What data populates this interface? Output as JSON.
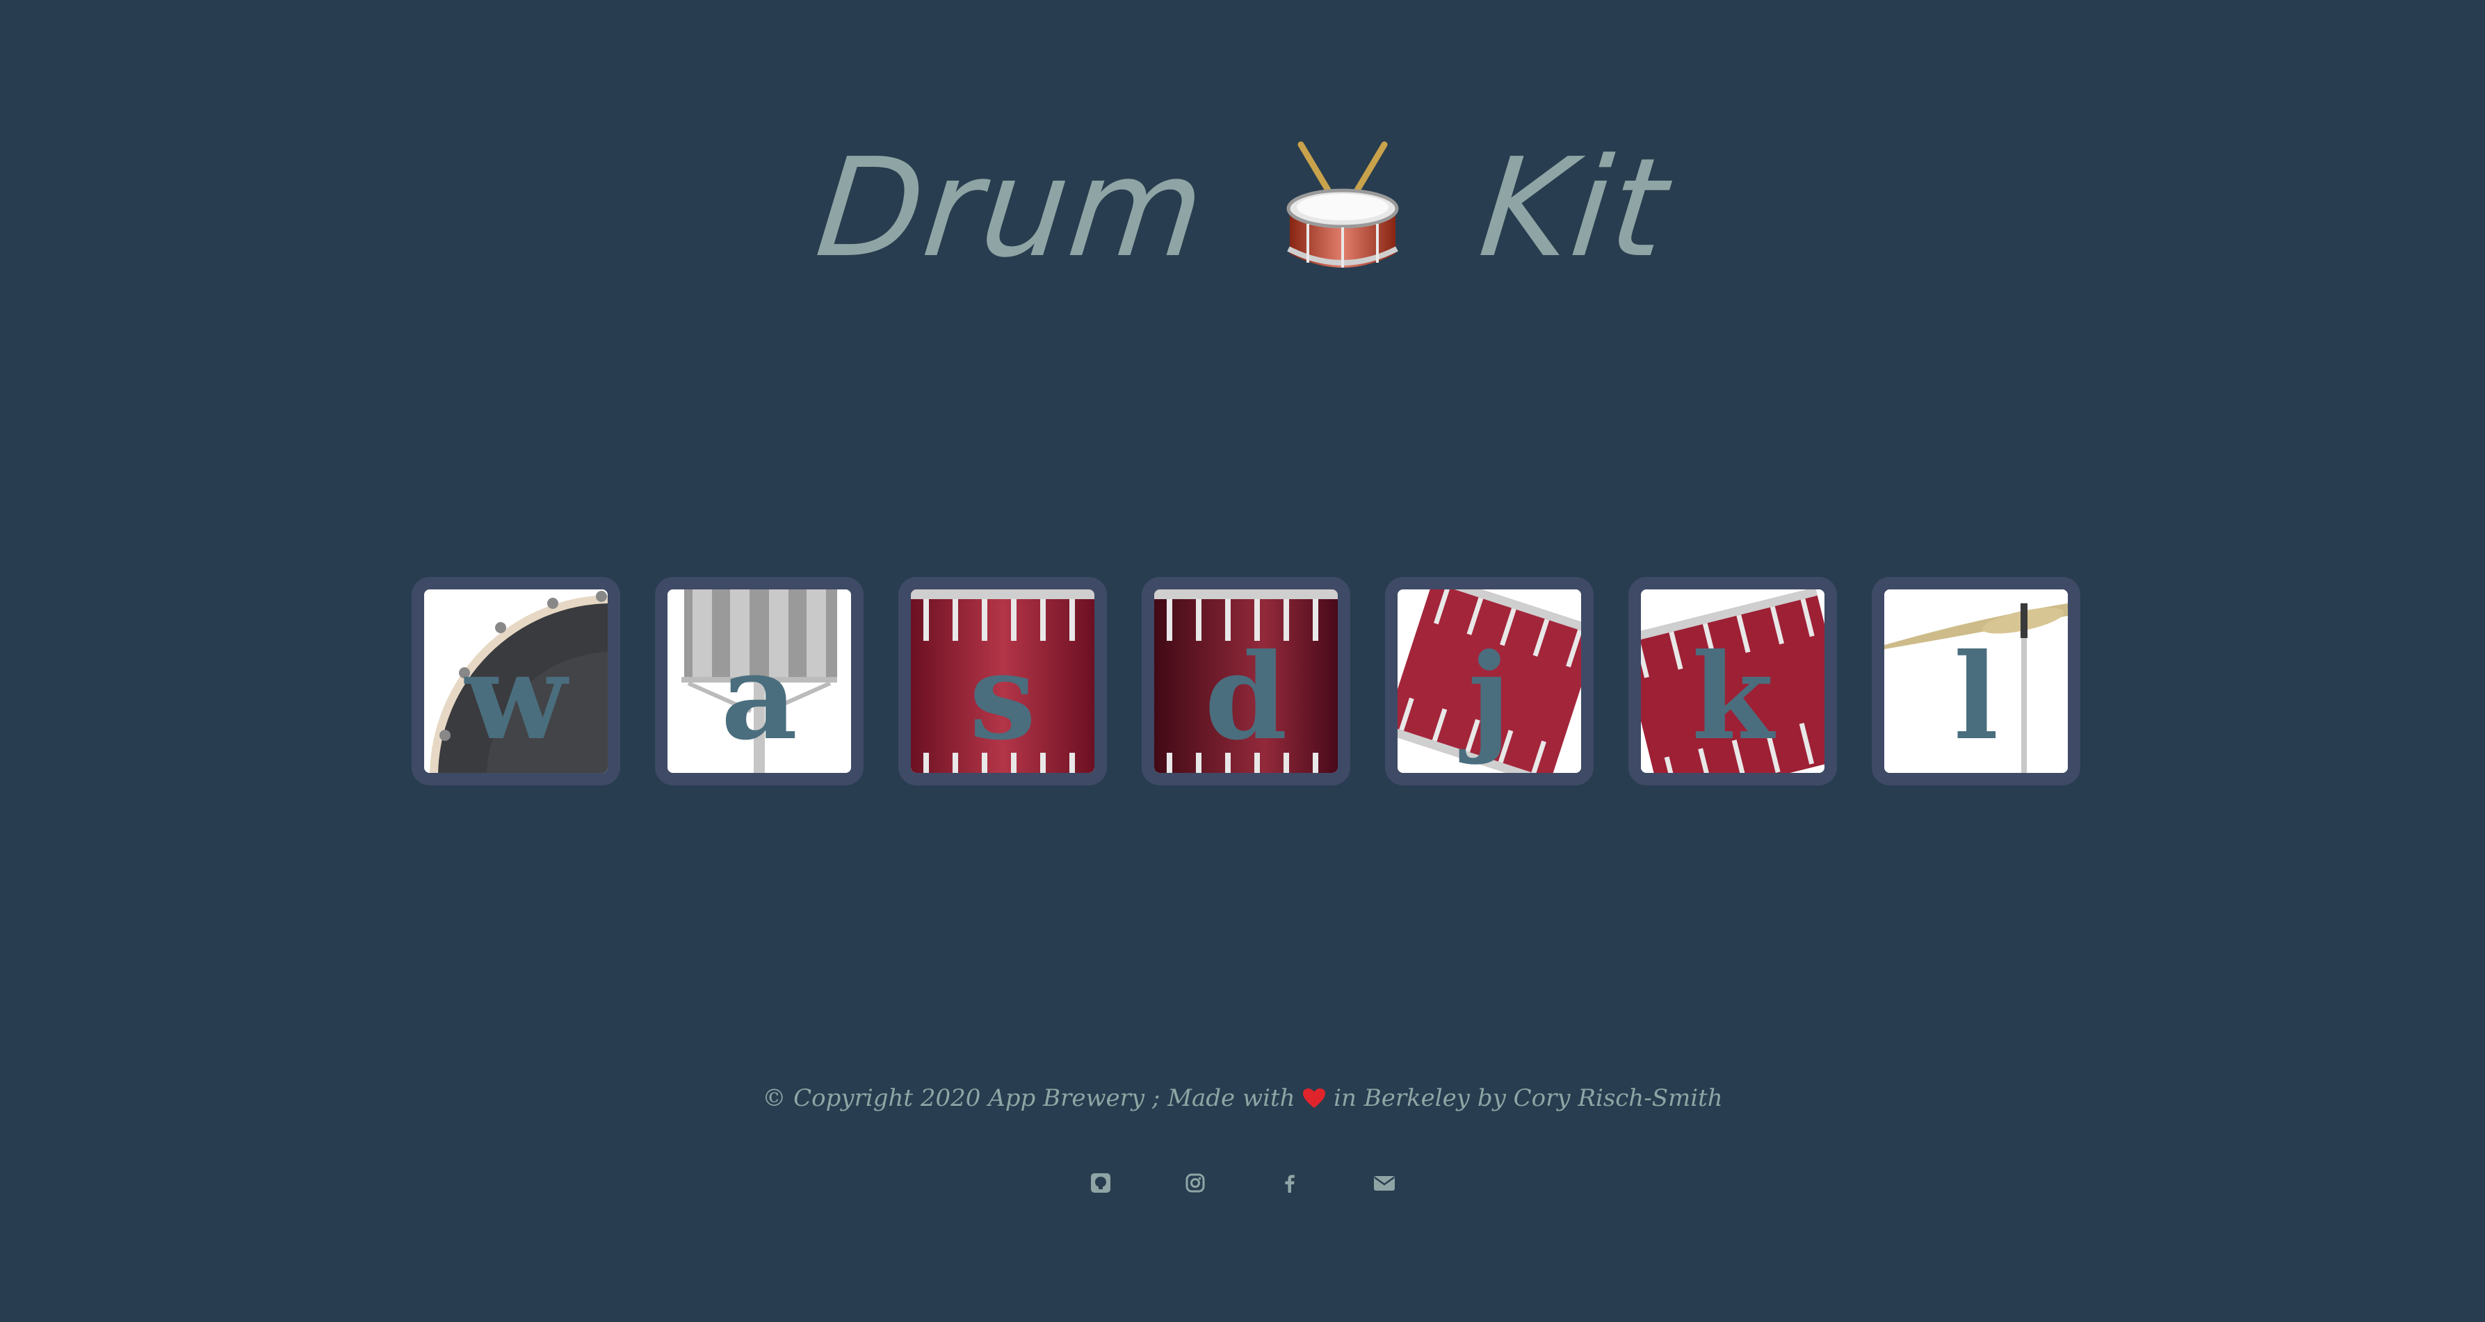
{
  "header": {
    "title_left": "Drum",
    "title_right": "Kit",
    "title_emoji_icon": "drum-icon"
  },
  "pads": [
    {
      "key": "w",
      "instrument": "kick-drum-icon"
    },
    {
      "key": "a",
      "instrument": "hi-hat-icon"
    },
    {
      "key": "s",
      "instrument": "snare-icon"
    },
    {
      "key": "d",
      "instrument": "snare-dark-icon"
    },
    {
      "key": "j",
      "instrument": "tom-1-icon"
    },
    {
      "key": "k",
      "instrument": "tom-2-icon"
    },
    {
      "key": "l",
      "instrument": "cymbal-icon"
    }
  ],
  "footer": {
    "copyright_prefix": "© Copyright 2020 App Brewery ; Made with",
    "copyright_suffix": "in Berkeley by Cory Risch-Smith",
    "heart_icon": "heart-icon"
  },
  "socials": [
    {
      "icon": "github-icon"
    },
    {
      "icon": "instagram-icon"
    },
    {
      "icon": "facebook-icon"
    },
    {
      "icon": "email-icon"
    }
  ],
  "colors": {
    "background": "#283d4f",
    "title": "#8fa5a5",
    "pad_border": "#3e4a66",
    "pad_key": "#4a6e7e",
    "drum_red": "#9e2035",
    "heart": "#e0242b"
  }
}
